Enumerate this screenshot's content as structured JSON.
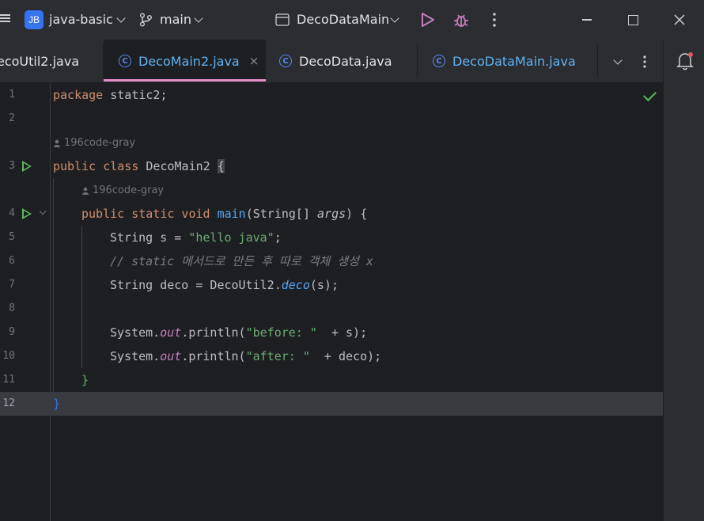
{
  "titlebar": {
    "project_badge": "JB",
    "project_name": "java-basic",
    "branch": "main",
    "run_config": "DecoDataMain",
    "icons": [
      "hamburger-menu-icon",
      "branch-icon",
      "run-config-icon",
      "run-icon",
      "debug-icon",
      "more-vertical-icon",
      "minimize-icon",
      "maximize-icon",
      "close-window-icon"
    ],
    "colors": {
      "run": "#c77dbb",
      "debug": "#c77dbb",
      "badge": "#3574f0"
    }
  },
  "tabs": [
    {
      "label": "ecoUtil2.java",
      "active": false
    },
    {
      "label": "DecoMain2.java",
      "active": true
    },
    {
      "label": "DecoData.java",
      "active": false
    },
    {
      "label": "DecoDataMain.java",
      "active": false
    }
  ],
  "tab_close": "×",
  "editor": {
    "author": "196code-gray",
    "line_numbers": [
      "1",
      "2",
      "3",
      "4",
      "5",
      "6",
      "7",
      "8",
      "9",
      "10",
      "11",
      "12"
    ],
    "current_line": "12",
    "lines": {
      "l1": {
        "kw": "package",
        "rest": " static2;"
      },
      "l3": {
        "kw": "public class",
        "name": " DecoMain2 ",
        "brace": "{"
      },
      "l4": {
        "kw": "public static void",
        "fn": " main",
        "open": "(String[] ",
        "param": "args",
        "close": ") {"
      },
      "l5": {
        "type": "String",
        "rest": " s = ",
        "str": "\"hello java\"",
        "end": ";"
      },
      "l6": {
        "comment": "// static 메서드로 만든 후 따로 객체 생성 x"
      },
      "l7": {
        "type": "String",
        "rest": " deco = DecoUtil2.",
        "method": "deco",
        "end": "(s);"
      },
      "l9": {
        "cls": "System.",
        "field": "out",
        "call": ".println(",
        "str": "\"before: \"",
        "end": "  + s);"
      },
      "l10": {
        "cls": "System.",
        "field": "out",
        "call": ".println(",
        "str": "\"after: \"",
        "end": "  + deco);"
      },
      "l11": {
        "brace": "}"
      },
      "l12": {
        "brace": "}"
      }
    }
  },
  "right_panel": {
    "icons": [
      "notifications-bell-icon"
    ]
  },
  "status": {
    "check": "no-problems-check-icon"
  }
}
